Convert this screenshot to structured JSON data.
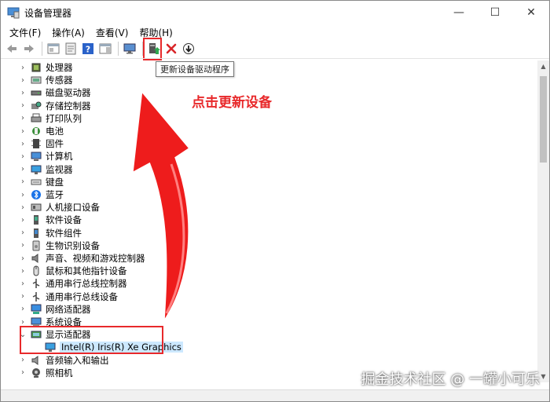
{
  "window": {
    "title": "设备管理器"
  },
  "window_controls": {
    "minimize": "—",
    "maximize": "☐",
    "close": "✕"
  },
  "menu": [
    "文件(F)",
    "操作(A)",
    "查看(V)",
    "帮助(H)"
  ],
  "toolbar": {
    "tooltip": "更新设备驱动程序",
    "icons": [
      "back-icon",
      "forward-icon",
      "properties-pane-icon",
      "properties-icon",
      "help-icon",
      "show-hide-console-icon",
      "monitor-icon",
      "update-driver-icon",
      "uninstall-icon",
      "scan-hardware-icon"
    ]
  },
  "annotation": "点击更新设备",
  "tree": {
    "categories": [
      {
        "label": "处理器",
        "icon": "processor-icon"
      },
      {
        "label": "传感器",
        "icon": "sensor-icon"
      },
      {
        "label": "磁盘驱动器",
        "icon": "disk-drive-icon"
      },
      {
        "label": "存储控制器",
        "icon": "storage-controller-icon"
      },
      {
        "label": "打印队列",
        "icon": "printer-icon"
      },
      {
        "label": "电池",
        "icon": "battery-icon"
      },
      {
        "label": "固件",
        "icon": "firmware-icon"
      },
      {
        "label": "计算机",
        "icon": "computer-icon"
      },
      {
        "label": "监视器",
        "icon": "monitor-icon"
      },
      {
        "label": "键盘",
        "icon": "keyboard-icon"
      },
      {
        "label": "蓝牙",
        "icon": "bluetooth-icon"
      },
      {
        "label": "人机接口设备",
        "icon": "hid-icon"
      },
      {
        "label": "软件设备",
        "icon": "software-device-icon"
      },
      {
        "label": "软件组件",
        "icon": "software-component-icon"
      },
      {
        "label": "生物识别设备",
        "icon": "biometric-icon"
      },
      {
        "label": "声音、视频和游戏控制器",
        "icon": "sound-icon"
      },
      {
        "label": "鼠标和其他指针设备",
        "icon": "mouse-icon"
      },
      {
        "label": "通用串行总线控制器",
        "icon": "usb-icon"
      },
      {
        "label": "通用串行总线设备",
        "icon": "usb-device-icon"
      },
      {
        "label": "网络适配器",
        "icon": "network-adapter-icon"
      },
      {
        "label": "系统设备",
        "icon": "system-device-icon"
      },
      {
        "label": "显示适配器",
        "icon": "display-adapter-icon",
        "expanded": true
      },
      {
        "label": "音频输入和输出",
        "icon": "audio-io-icon"
      },
      {
        "label": "照相机",
        "icon": "camera-icon"
      }
    ],
    "display_child": "Intel(R) Iris(R) Xe Graphics"
  },
  "watermark": "掘金技术社区 @ 一罐小可乐",
  "colors": {
    "highlight_red": "#e8292b",
    "selection": "#cce8ff"
  }
}
